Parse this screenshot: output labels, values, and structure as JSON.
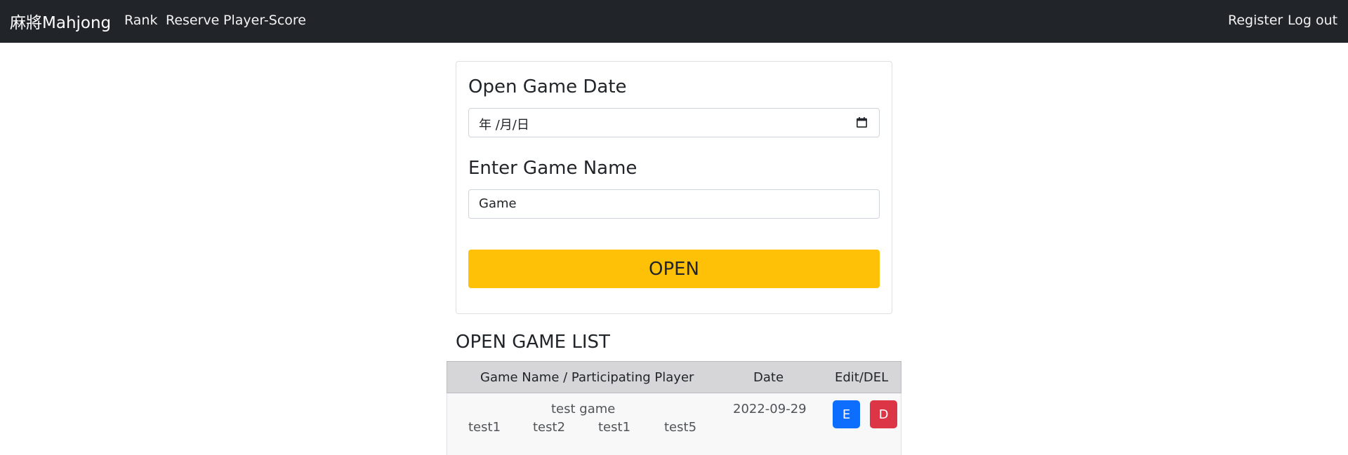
{
  "navbar": {
    "brand": "麻將Mahjong",
    "links": [
      "Rank",
      "Reserve",
      "Player-Score"
    ],
    "right_links": [
      "Register",
      "Log out"
    ]
  },
  "form": {
    "date_label": "Open Game Date",
    "date_value": "年 /月/日",
    "name_label": "Enter Game Name",
    "name_value": "Game",
    "submit_label": "OPEN",
    "icons": {
      "calendar": "calendar-icon"
    }
  },
  "game_list": {
    "title": "OPEN GAME LIST",
    "headers": [
      "Game Name / Participating Player",
      "Date",
      "Edit/DEL"
    ],
    "rows": [
      {
        "game_name": "test game",
        "players": [
          "test1",
          "test2",
          "test1",
          "test5"
        ],
        "date": "2022-09-29",
        "edit_label": "E",
        "delete_label": "D"
      }
    ]
  },
  "colors": {
    "navbar": "#212529",
    "open_button": "#ffc107",
    "edit_button": "#0d6efd",
    "delete_button": "#dc3545",
    "table_header": "#d6d6d8"
  }
}
